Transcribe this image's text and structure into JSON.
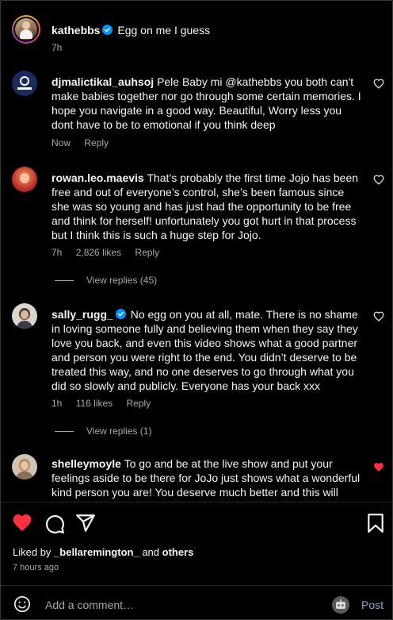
{
  "caption": {
    "username": "kathebbs",
    "text": "Egg on me I guess",
    "time": "7h"
  },
  "comments": [
    {
      "username": "djmalictikal_auhsoj",
      "text": "Pele Baby mi @kathebbs you both can't make babies together nor go through some certain memories. I hope you navigate in a good way. Beautiful, Worry less you dont have to be to emotional if you think deep",
      "time": "Now",
      "likes": "",
      "reply": "Reply",
      "liked": false,
      "view_replies": ""
    },
    {
      "username": "rowan.leo.maevis",
      "text": "That’s probably the first time Jojo has been free and out of everyone’s control, she’s been famous since she was so young and has just had the opportunity to be free and think for herself! unfortunately you got hurt in that process but I think this is such a huge step for Jojo.",
      "time": "7h",
      "likes": "2,826 likes",
      "reply": "Reply",
      "liked": false,
      "view_replies": "View replies (45)"
    },
    {
      "username": "sally_rugg_",
      "text": "No egg on you at all, mate. There is no shame in loving someone fully and believing them when they say they love you back, and even this video shows what a good partner and person you were right to the end. You didn’t deserve to be treated this way, and no one deserves to go through what you did so slowly and publicly. Everyone has your back xxx",
      "time": "1h",
      "likes": "116 likes",
      "reply": "Reply",
      "liked": false,
      "view_replies": "View replies (1)"
    },
    {
      "username": "shelleymoyle",
      "text": "To go and be at the live show and put your feelings aside to be there for JoJo just shows what a wonderful kind person you are! You deserve much better and this will",
      "time": "",
      "likes": "",
      "reply": "",
      "liked": true,
      "view_replies": ""
    }
  ],
  "footer": {
    "liked_by_prefix": "Liked by",
    "liked_by_user": "_bellaremington_",
    "liked_by_and": "and",
    "liked_by_others": "others",
    "timestamp": "7 hours ago",
    "comment_placeholder": "Add a comment…",
    "post_label": "Post"
  },
  "colors": {
    "background": "#000000",
    "liked_heart": "#ff3040",
    "verified": "#0095f6",
    "post_button": "#85a9d6",
    "muted_text": "#a8a8a8"
  }
}
